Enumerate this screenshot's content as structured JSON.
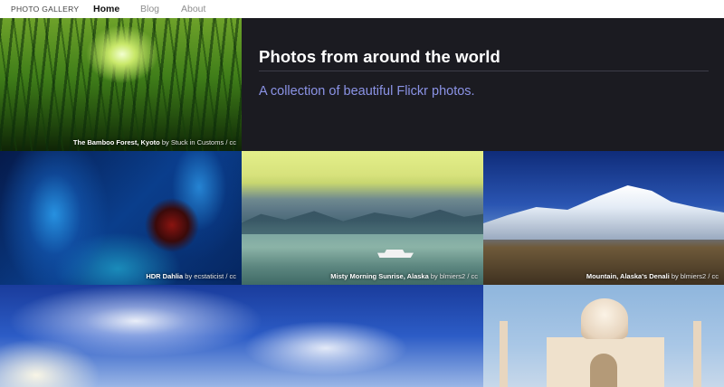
{
  "nav": {
    "brand": "PHOTO GALLERY",
    "links": [
      {
        "label": "Home",
        "active": true
      },
      {
        "label": "Blog",
        "active": false
      },
      {
        "label": "About",
        "active": false
      }
    ]
  },
  "hero": {
    "title": "Photos from around the world",
    "subtitle": "A collection of beautiful Flickr photos."
  },
  "photos": [
    {
      "title": "The Bamboo Forest, Kyoto",
      "by": "by",
      "author": "Stuck in Customs",
      "license": "/ cc"
    },
    {
      "title": "HDR Dahlia",
      "by": "by",
      "author": "ecstaticist",
      "license": "/ cc"
    },
    {
      "title": "Misty Morning Sunrise, Alaska",
      "by": "by",
      "author": "blmiers2",
      "license": "/ cc"
    },
    {
      "title": "Mountain, Alaska's Denali",
      "by": "by",
      "author": "blmiers2",
      "license": "/ cc"
    }
  ],
  "colors": {
    "background": "#1b1b21",
    "subtitle": "#8b93e6",
    "nav_bg": "#ffffff"
  }
}
